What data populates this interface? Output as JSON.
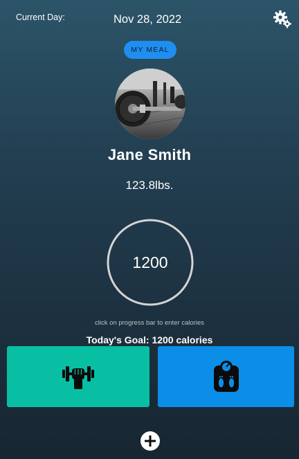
{
  "header": {
    "current_day_label": "Current Day:",
    "date": "Nov 28, 2022",
    "settings_icon": "gear-icon"
  },
  "meal_button": {
    "label": "MY MEAL",
    "color": "#1f8ef1"
  },
  "profile": {
    "name": "Jane Smith",
    "weight": "123.8lbs.",
    "avatar_icon": "barbell-photo"
  },
  "calories": {
    "value": "1200",
    "hint": "click on progress bar to enter calories",
    "goal": "Today's Goal: 1200 calories",
    "progress": 0
  },
  "tiles": {
    "workout": {
      "icon": "dumbbell-fist-icon",
      "color": "#08bfa4"
    },
    "weight": {
      "icon": "bathroom-scale-icon",
      "color": "#0b8ee8"
    }
  },
  "add_button_icon": "plus-circle-icon"
}
